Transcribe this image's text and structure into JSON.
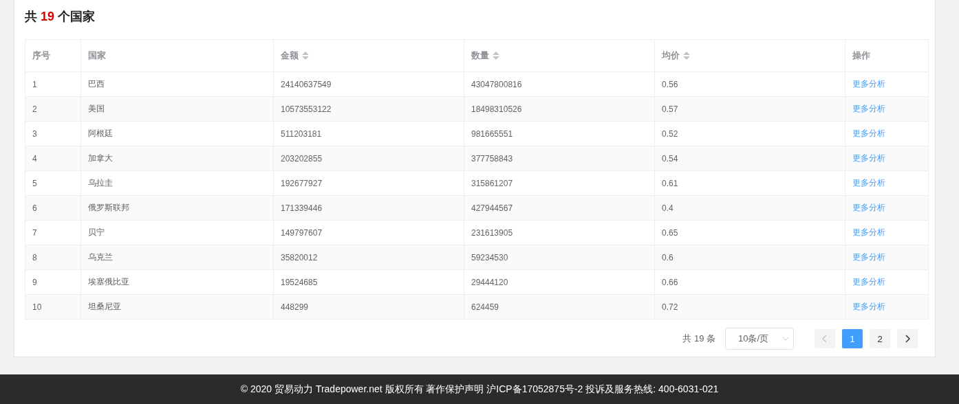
{
  "heading": {
    "prefix": "共",
    "count": "19",
    "suffix": "个国家"
  },
  "table": {
    "columns": [
      {
        "label": "序号",
        "sortable": false
      },
      {
        "label": "国家",
        "sortable": false
      },
      {
        "label": "金额",
        "sortable": true
      },
      {
        "label": "数量",
        "sortable": true
      },
      {
        "label": "均价",
        "sortable": true
      },
      {
        "label": "操作",
        "sortable": false
      }
    ],
    "rows": [
      {
        "index": "1",
        "country": "巴西",
        "amount": "24140637549",
        "quantity": "43047800816",
        "price": "0.56",
        "action": "更多分析"
      },
      {
        "index": "2",
        "country": "美国",
        "amount": "10573553122",
        "quantity": "18498310526",
        "price": "0.57",
        "action": "更多分析"
      },
      {
        "index": "3",
        "country": "阿根廷",
        "amount": "511203181",
        "quantity": "981665551",
        "price": "0.52",
        "action": "更多分析"
      },
      {
        "index": "4",
        "country": "加拿大",
        "amount": "203202855",
        "quantity": "377758843",
        "price": "0.54",
        "action": "更多分析"
      },
      {
        "index": "5",
        "country": "乌拉圭",
        "amount": "192677927",
        "quantity": "315861207",
        "price": "0.61",
        "action": "更多分析"
      },
      {
        "index": "6",
        "country": "俄罗斯联邦",
        "amount": "171339446",
        "quantity": "427944567",
        "price": "0.4",
        "action": "更多分析"
      },
      {
        "index": "7",
        "country": "贝宁",
        "amount": "149797607",
        "quantity": "231613905",
        "price": "0.65",
        "action": "更多分析"
      },
      {
        "index": "8",
        "country": "乌克兰",
        "amount": "35820012",
        "quantity": "59234530",
        "price": "0.6",
        "action": "更多分析"
      },
      {
        "index": "9",
        "country": "埃塞俄比亚",
        "amount": "19524685",
        "quantity": "29444120",
        "price": "0.66",
        "action": "更多分析"
      },
      {
        "index": "10",
        "country": "坦桑尼亚",
        "amount": "448299",
        "quantity": "624459",
        "price": "0.72",
        "action": "更多分析"
      }
    ]
  },
  "pagination": {
    "total": "共 19 条",
    "page_size": "10条/页",
    "prev_disabled": true,
    "pages": [
      {
        "label": "1",
        "selected": true
      },
      {
        "label": "2",
        "selected": false
      }
    ],
    "next_disabled": false
  },
  "footer": {
    "text": "© 2020 贸易动力 Tradepower.net 版权所有 著作保护声明 沪ICP备17052875号-2 投诉及服务热线: 400-6031-021"
  }
}
